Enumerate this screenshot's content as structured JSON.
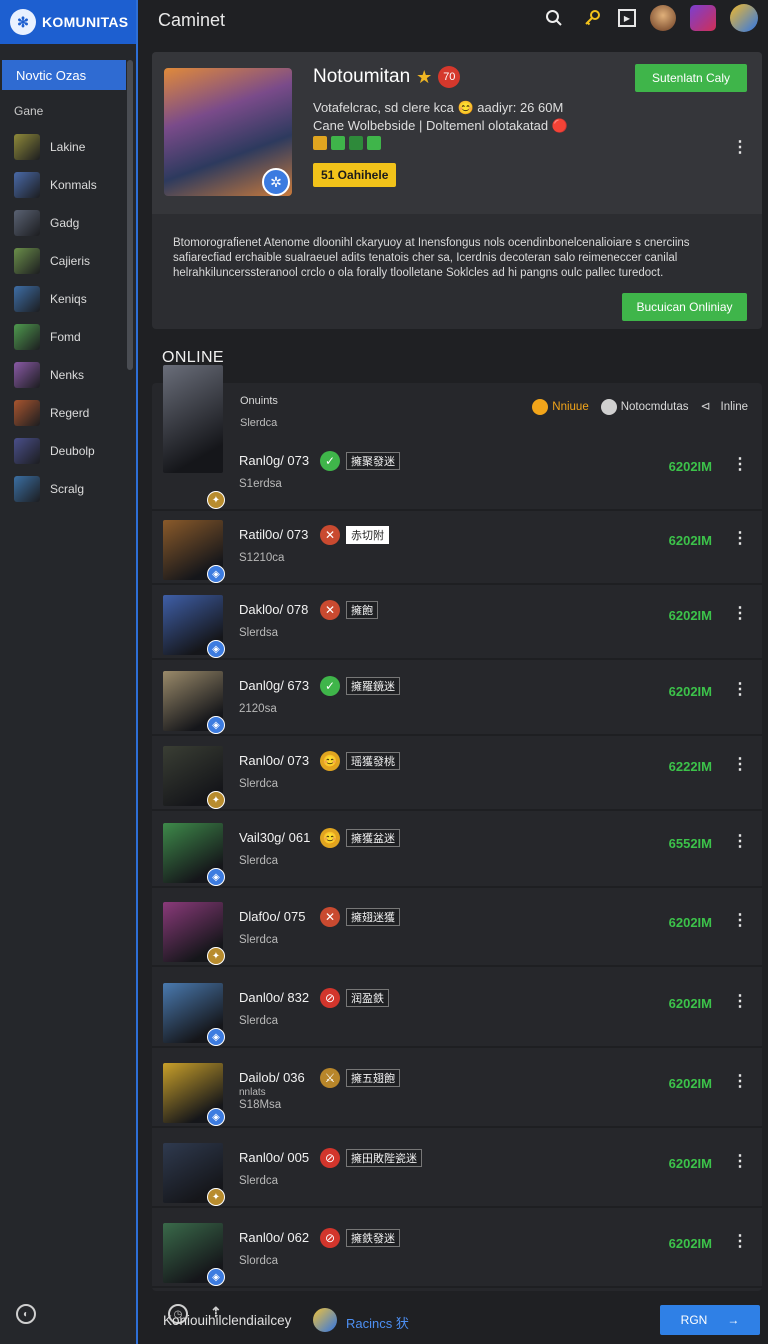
{
  "brand": {
    "name": "KOMUNITAS",
    "logo_glyph": "✻"
  },
  "window": {
    "title": "Caminet"
  },
  "topbar": {
    "icons": [
      "search-icon",
      "key-icon",
      "play-icon",
      "user-avatar",
      "game-avatar",
      "profile-avatar"
    ]
  },
  "sidebar": {
    "active_item": "Novtic Ozas",
    "section_label": "Gane",
    "items": [
      {
        "label": "Lakine",
        "color": "#8f8a3a"
      },
      {
        "label": "Konmals",
        "color": "#4a6aa8"
      },
      {
        "label": "Gadg",
        "color": "#5a6273"
      },
      {
        "label": "Cajieris",
        "color": "#6b8f4a"
      },
      {
        "label": "Keniqs",
        "color": "#3e6ea6"
      },
      {
        "label": "Fomd",
        "color": "#4f9a4e"
      },
      {
        "label": "Nenks",
        "color": "#8a5aa6"
      },
      {
        "label": "Regerd",
        "color": "#a8552f"
      },
      {
        "label": "Deubolp",
        "color": "#4a4f8a"
      },
      {
        "label": "Scralg",
        "color": "#3b6fa3"
      }
    ]
  },
  "hero": {
    "name": "Notoumitan",
    "badge_number": "70",
    "description_line1": "Votafelcrac, sd clere kca 😊 aadiyr: 26 60M",
    "description_line2": "Cane Wolbebside | Doltemenl olotakatad 🔴",
    "tag": "51 Oahihele",
    "button_primary": "Sutenlatn Caly",
    "button_secondary": "Bucuican Onliniay",
    "body": "Btomorografienet Atenome dloonihl ckaryuoy at Inensfongus nols ocendinbonelcenalioiare s cnerciins safiarecfiad erchaible sualraeuel adits tenatois cher sa, Icerdnis decoteran salo reimeneccer canilal helrahkiluncerssteranool crclo o ola forally tloolletane Soklcles ad hi pangns oulc pallec turedoct."
  },
  "online": {
    "title": "ONLINE",
    "header_label": "Onuints",
    "header_sub": "Slerdca",
    "filters": [
      {
        "label": "Nniuue",
        "active": true
      },
      {
        "label": "Notocmdutas",
        "active": false
      },
      {
        "label": "Inline",
        "active": false
      }
    ],
    "rows": [
      {
        "name": "Ranl0g/ 073",
        "sub": "S1erdsa",
        "status": "✓",
        "status_color": "#3fb54a",
        "label": "擁聚發迷",
        "label_style": "dark",
        "value": "6202IM",
        "thumb": "#6a6e7a",
        "badge": "gold"
      },
      {
        "name": "Ratil0o/ 073",
        "sub": "S1210ca",
        "status": "✕",
        "status_color": "#c94a30",
        "label": "赤切附",
        "label_style": "white",
        "value": "6202IM",
        "thumb": "#8a5a2a",
        "badge": "blue"
      },
      {
        "name": "Dakl0o/ 078",
        "sub": "Slerdsa",
        "status": "✕",
        "status_color": "#c94a30",
        "label": "擁飽",
        "label_style": "dark",
        "value": "6202IM",
        "thumb": "#3f5fa8",
        "badge": "blue"
      },
      {
        "name": "Danl0g/ 673",
        "sub": "2120sa",
        "status": "✓",
        "status_color": "#3fb54a",
        "label": "擁羅鏡迷",
        "label_style": "dark",
        "value": "6202IM",
        "thumb": "#9a8a6a",
        "badge": "blue"
      },
      {
        "name": "Ranl0o/ 073",
        "sub": "Slerdca",
        "status": "😊",
        "status_color": "#e0a520",
        "label": "瑶獲發桃",
        "label_style": "dark",
        "value": "6222IM",
        "thumb": "#3a3e34",
        "badge": "gold"
      },
      {
        "name": "Vail30g/ 061",
        "sub": "Slerdca",
        "status": "😊",
        "status_color": "#e0a520",
        "label": "擁獲盆迷",
        "label_style": "dark",
        "value": "6552IM",
        "thumb": "#3e8a4a",
        "badge": "blue"
      },
      {
        "name": "Dlaf0o/ 075",
        "sub": "Slerdca",
        "status": "✕",
        "status_color": "#c94a30",
        "label": "擁翅迷獲",
        "label_style": "dark",
        "value": "6202IM",
        "thumb": "#8a3a7a",
        "badge": "gold"
      },
      {
        "name": "Danl0o/ 832",
        "sub": "Slerdca",
        "status": "⊘",
        "status_color": "#d2352c",
        "label": "润盈鉄",
        "label_style": "dark",
        "value": "6202IM",
        "thumb": "#4a7ab0",
        "badge": "blue"
      },
      {
        "name": "Dailob/ 036",
        "sub": "S18Msa",
        "extra": "nnlats",
        "status": "⚔",
        "status_color": "#b8862a",
        "label": "擁五翅飽",
        "label_style": "dark",
        "value": "6202IM",
        "thumb": "#c9a02a",
        "badge": "blue"
      },
      {
        "name": "Ranl0o/ 005",
        "sub": "Slerdca",
        "status": "⊘",
        "status_color": "#d2352c",
        "label": "擁田敗陛瓷迷",
        "label_style": "dark",
        "value": "6202IM",
        "thumb": "#2f3a4f",
        "badge": "gold"
      },
      {
        "name": "Ranl0o/ 062",
        "sub": "Slordca",
        "status": "⊘",
        "status_color": "#d2352c",
        "label": "擁鉄發迷",
        "label_style": "dark",
        "value": "6202IM",
        "thumb": "#3a6a4a",
        "badge": "blue"
      }
    ]
  },
  "footer": {
    "text": "Koniouihilclendiailcey",
    "link": "Racincs 犾",
    "button_label": "RGN",
    "button_arrow": "→"
  },
  "colors": {
    "accent": "#2f6bd2",
    "green": "#3fb54a",
    "value_green": "#3cc24a",
    "tag_yellow": "#f2c31a"
  }
}
